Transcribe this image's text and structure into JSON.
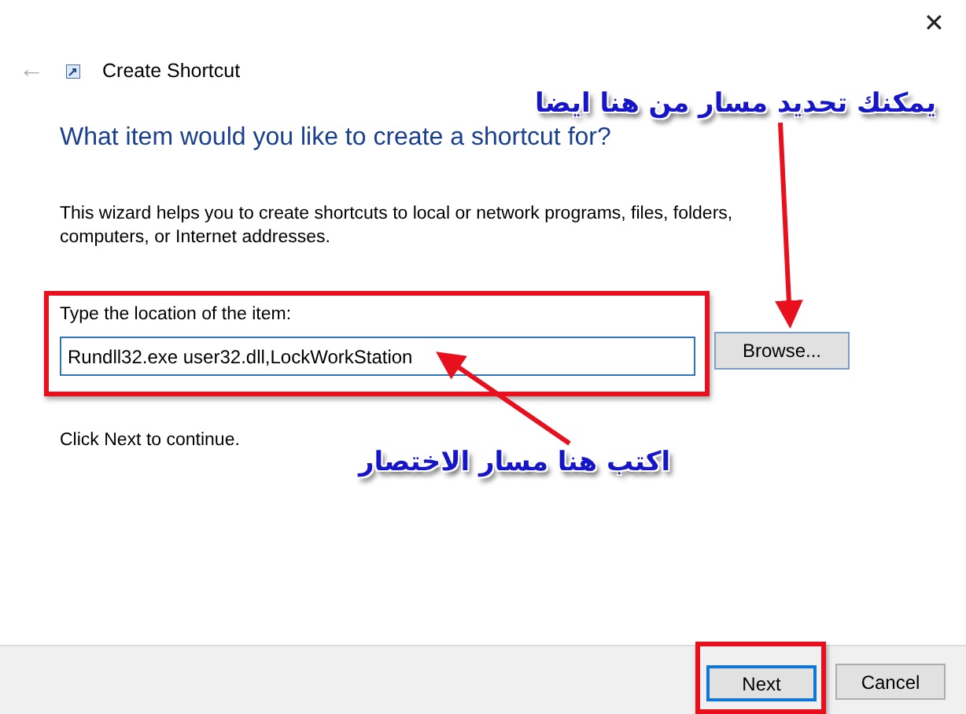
{
  "window": {
    "title": "Create Shortcut",
    "close": "✕",
    "back": "←"
  },
  "heading": "What item would you like to create a shortcut for?",
  "description": "This wizard helps you to create shortcuts to local or network programs, files, folders, computers, or Internet addresses.",
  "location": {
    "label": "Type the location of the item:",
    "value": "Rundll32.exe user32.dll,LockWorkStation"
  },
  "browse_button": "Browse...",
  "hint": "Click Next to continue.",
  "buttons": [
    {
      "label": "Next",
      "default": true
    },
    {
      "label": "Cancel",
      "default": false
    }
  ],
  "annotations": [
    {
      "text": "يمكنك تحديد مسار من هنا ايضا"
    },
    {
      "text": "اكتب هنا مسار الاختصار"
    }
  ]
}
